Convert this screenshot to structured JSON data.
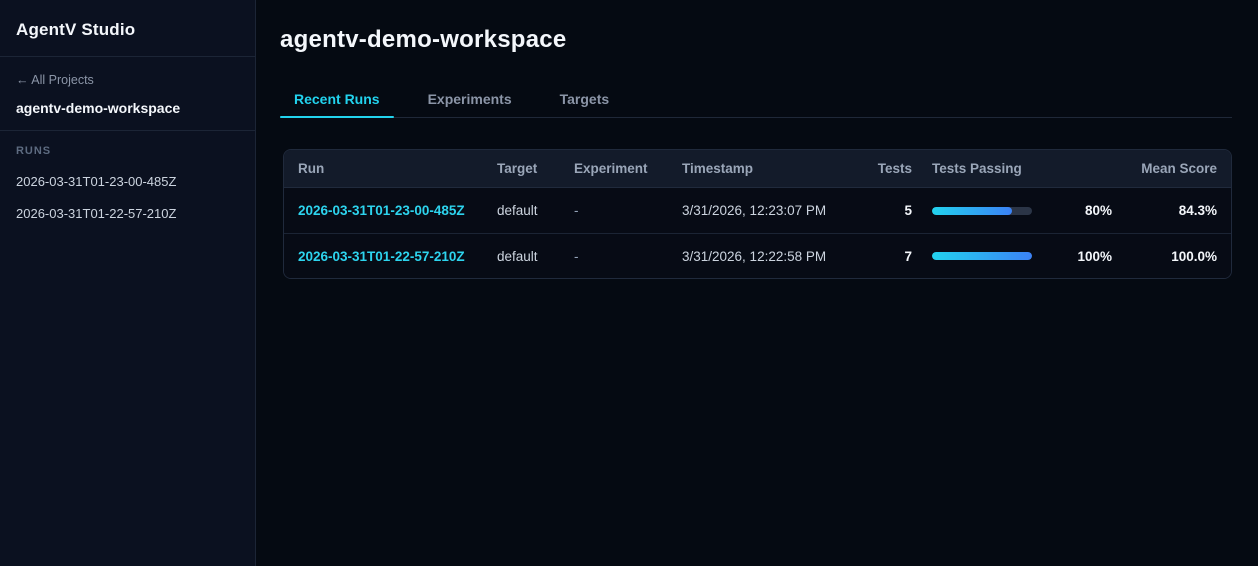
{
  "sidebar": {
    "app_title": "AgentV Studio",
    "back_link": "← All Projects",
    "workspace_name": "agentv-demo-workspace",
    "runs_section_label": "RUNS",
    "runs": [
      "2026-03-31T01-23-00-485Z",
      "2026-03-31T01-22-57-210Z"
    ]
  },
  "main": {
    "page_title": "agentv-demo-workspace",
    "tabs": [
      {
        "label": "Recent Runs",
        "active": true
      },
      {
        "label": "Experiments",
        "active": false
      },
      {
        "label": "Targets",
        "active": false
      }
    ],
    "table": {
      "columns": {
        "run": "Run",
        "target": "Target",
        "experiment": "Experiment",
        "timestamp": "Timestamp",
        "tests": "Tests",
        "tests_passing": "Tests Passing",
        "mean_score": "Mean Score"
      },
      "rows": [
        {
          "run": "2026-03-31T01-23-00-485Z",
          "target": "default",
          "experiment": "-",
          "timestamp": "3/31/2026, 12:23:07 PM",
          "tests": "5",
          "passing_pct": 80,
          "passing_label": "80%",
          "mean_score": "84.3%"
        },
        {
          "run": "2026-03-31T01-22-57-210Z",
          "target": "default",
          "experiment": "-",
          "timestamp": "3/31/2026, 12:22:58 PM",
          "tests": "7",
          "passing_pct": 100,
          "passing_label": "100%",
          "mean_score": "100.0%"
        }
      ]
    }
  },
  "colors": {
    "accent_cyan": "#22d3ee",
    "accent_blue": "#3b82f6",
    "sidebar_bg": "#0b1120",
    "main_bg": "#050a12",
    "header_row_bg": "#131b2a",
    "border": "#202a3c"
  }
}
